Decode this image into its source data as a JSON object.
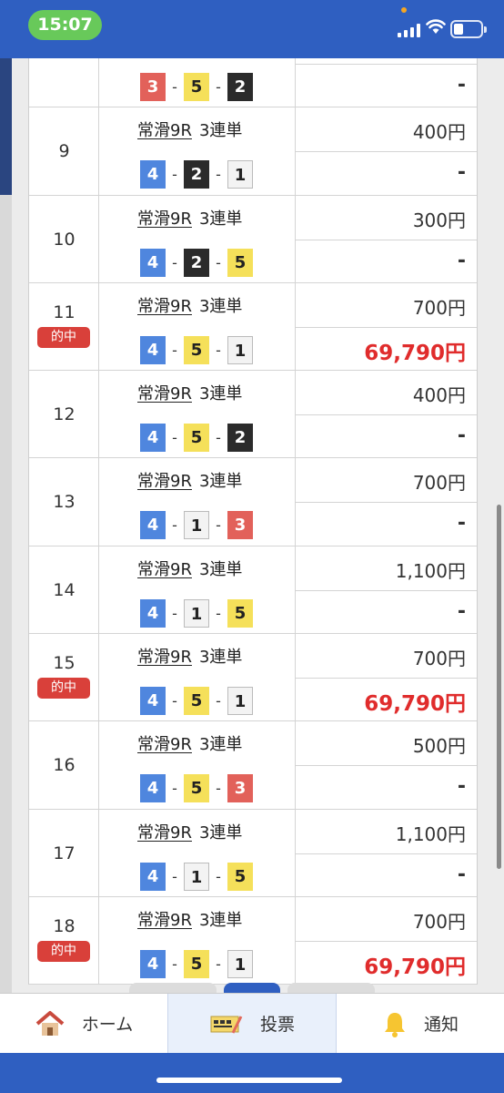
{
  "status_bar": {
    "time": "15:07"
  },
  "rows": [
    {
      "num": "",
      "hit": false,
      "race": "",
      "type": "",
      "combo": [
        3,
        5,
        2
      ],
      "stake": "",
      "payout": "-"
    },
    {
      "num": "9",
      "hit": false,
      "race": "常滑9R",
      "type": "3連単",
      "combo": [
        4,
        2,
        1
      ],
      "stake": "400円",
      "payout": "-"
    },
    {
      "num": "10",
      "hit": false,
      "race": "常滑9R",
      "type": "3連単",
      "combo": [
        4,
        2,
        5
      ],
      "stake": "300円",
      "payout": "-"
    },
    {
      "num": "11",
      "hit": true,
      "race": "常滑9R",
      "type": "3連単",
      "combo": [
        4,
        5,
        1
      ],
      "stake": "700円",
      "payout": "69,790円"
    },
    {
      "num": "12",
      "hit": false,
      "race": "常滑9R",
      "type": "3連単",
      "combo": [
        4,
        5,
        2
      ],
      "stake": "400円",
      "payout": "-"
    },
    {
      "num": "13",
      "hit": false,
      "race": "常滑9R",
      "type": "3連単",
      "combo": [
        4,
        1,
        3
      ],
      "stake": "700円",
      "payout": "-"
    },
    {
      "num": "14",
      "hit": false,
      "race": "常滑9R",
      "type": "3連単",
      "combo": [
        4,
        1,
        5
      ],
      "stake": "1,100円",
      "payout": "-"
    },
    {
      "num": "15",
      "hit": true,
      "race": "常滑9R",
      "type": "3連単",
      "combo": [
        4,
        5,
        1
      ],
      "stake": "700円",
      "payout": "69,790円"
    },
    {
      "num": "16",
      "hit": false,
      "race": "常滑9R",
      "type": "3連単",
      "combo": [
        4,
        5,
        3
      ],
      "stake": "500円",
      "payout": "-"
    },
    {
      "num": "17",
      "hit": false,
      "race": "常滑9R",
      "type": "3連単",
      "combo": [
        4,
        1,
        5
      ],
      "stake": "1,100円",
      "payout": "-"
    },
    {
      "num": "18",
      "hit": true,
      "race": "常滑9R",
      "type": "3連単",
      "combo": [
        4,
        5,
        1
      ],
      "stake": "700円",
      "payout": "69,790円"
    }
  ],
  "hit_label": "的中",
  "combo_separator": "-",
  "boat_colors": {
    "1": "#f3f3f3",
    "2": "#2b2b2b",
    "3": "#e2615a",
    "4": "#4f86de",
    "5": "#f5e05a"
  },
  "tabs": [
    {
      "label": "ホーム",
      "icon": "house-icon"
    },
    {
      "label": "投票",
      "icon": "ticket-icon",
      "active": true
    },
    {
      "label": "通知",
      "icon": "bell-icon"
    }
  ]
}
